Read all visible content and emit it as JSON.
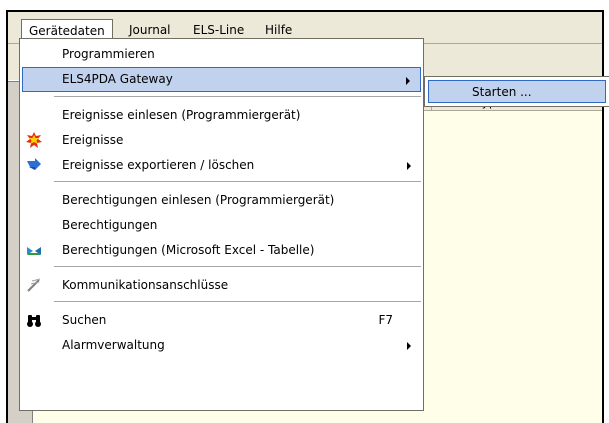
{
  "menubar": {
    "items": [
      "Gerätedaten",
      "Journal",
      "ELS-Line",
      "Hilfe"
    ]
  },
  "table": {
    "column_header": "Gerätetyp"
  },
  "menu": {
    "items": [
      {
        "label": "Programmieren",
        "icon": "none",
        "shortcut": "",
        "submenu": false
      },
      {
        "label": "ELS4PDA Gateway",
        "icon": "none",
        "shortcut": "",
        "submenu": true,
        "highlighted": true
      },
      {
        "label": "Ereignisse einlesen (Programmiergerät)",
        "icon": "none",
        "shortcut": "",
        "submenu": false
      },
      {
        "label": "Ereignisse",
        "icon": "events-burst-icon",
        "shortcut": "",
        "submenu": false
      },
      {
        "label": "Ereignisse exportieren / löschen",
        "icon": "export-arrow-icon",
        "shortcut": "",
        "submenu": true
      },
      {
        "label": "Berechtigungen einlesen (Programmiergerät)",
        "icon": "none",
        "shortcut": "",
        "submenu": false
      },
      {
        "label": "Berechtigungen",
        "icon": "none",
        "shortcut": "",
        "submenu": false
      },
      {
        "label": "Berechtigungen (Microsoft Excel - Tabelle)",
        "icon": "excel-icon",
        "shortcut": "",
        "submenu": false
      },
      {
        "label": "Kommunikationsanschlüsse",
        "icon": "connection-icon",
        "shortcut": "",
        "submenu": false
      },
      {
        "label": "Suchen",
        "icon": "binoculars-icon",
        "shortcut": "F7",
        "submenu": false
      },
      {
        "label": "Alarmverwaltung",
        "icon": "none",
        "shortcut": "",
        "submenu": true
      }
    ]
  },
  "submenu": {
    "items": [
      {
        "label": "Starten ...",
        "highlighted": true
      }
    ]
  },
  "colors": {
    "highlight_bg": "#c1d2ee",
    "highlight_border": "#316ac5",
    "content_bg": "#fffee9",
    "menubar_bg": "#ece9d8"
  }
}
